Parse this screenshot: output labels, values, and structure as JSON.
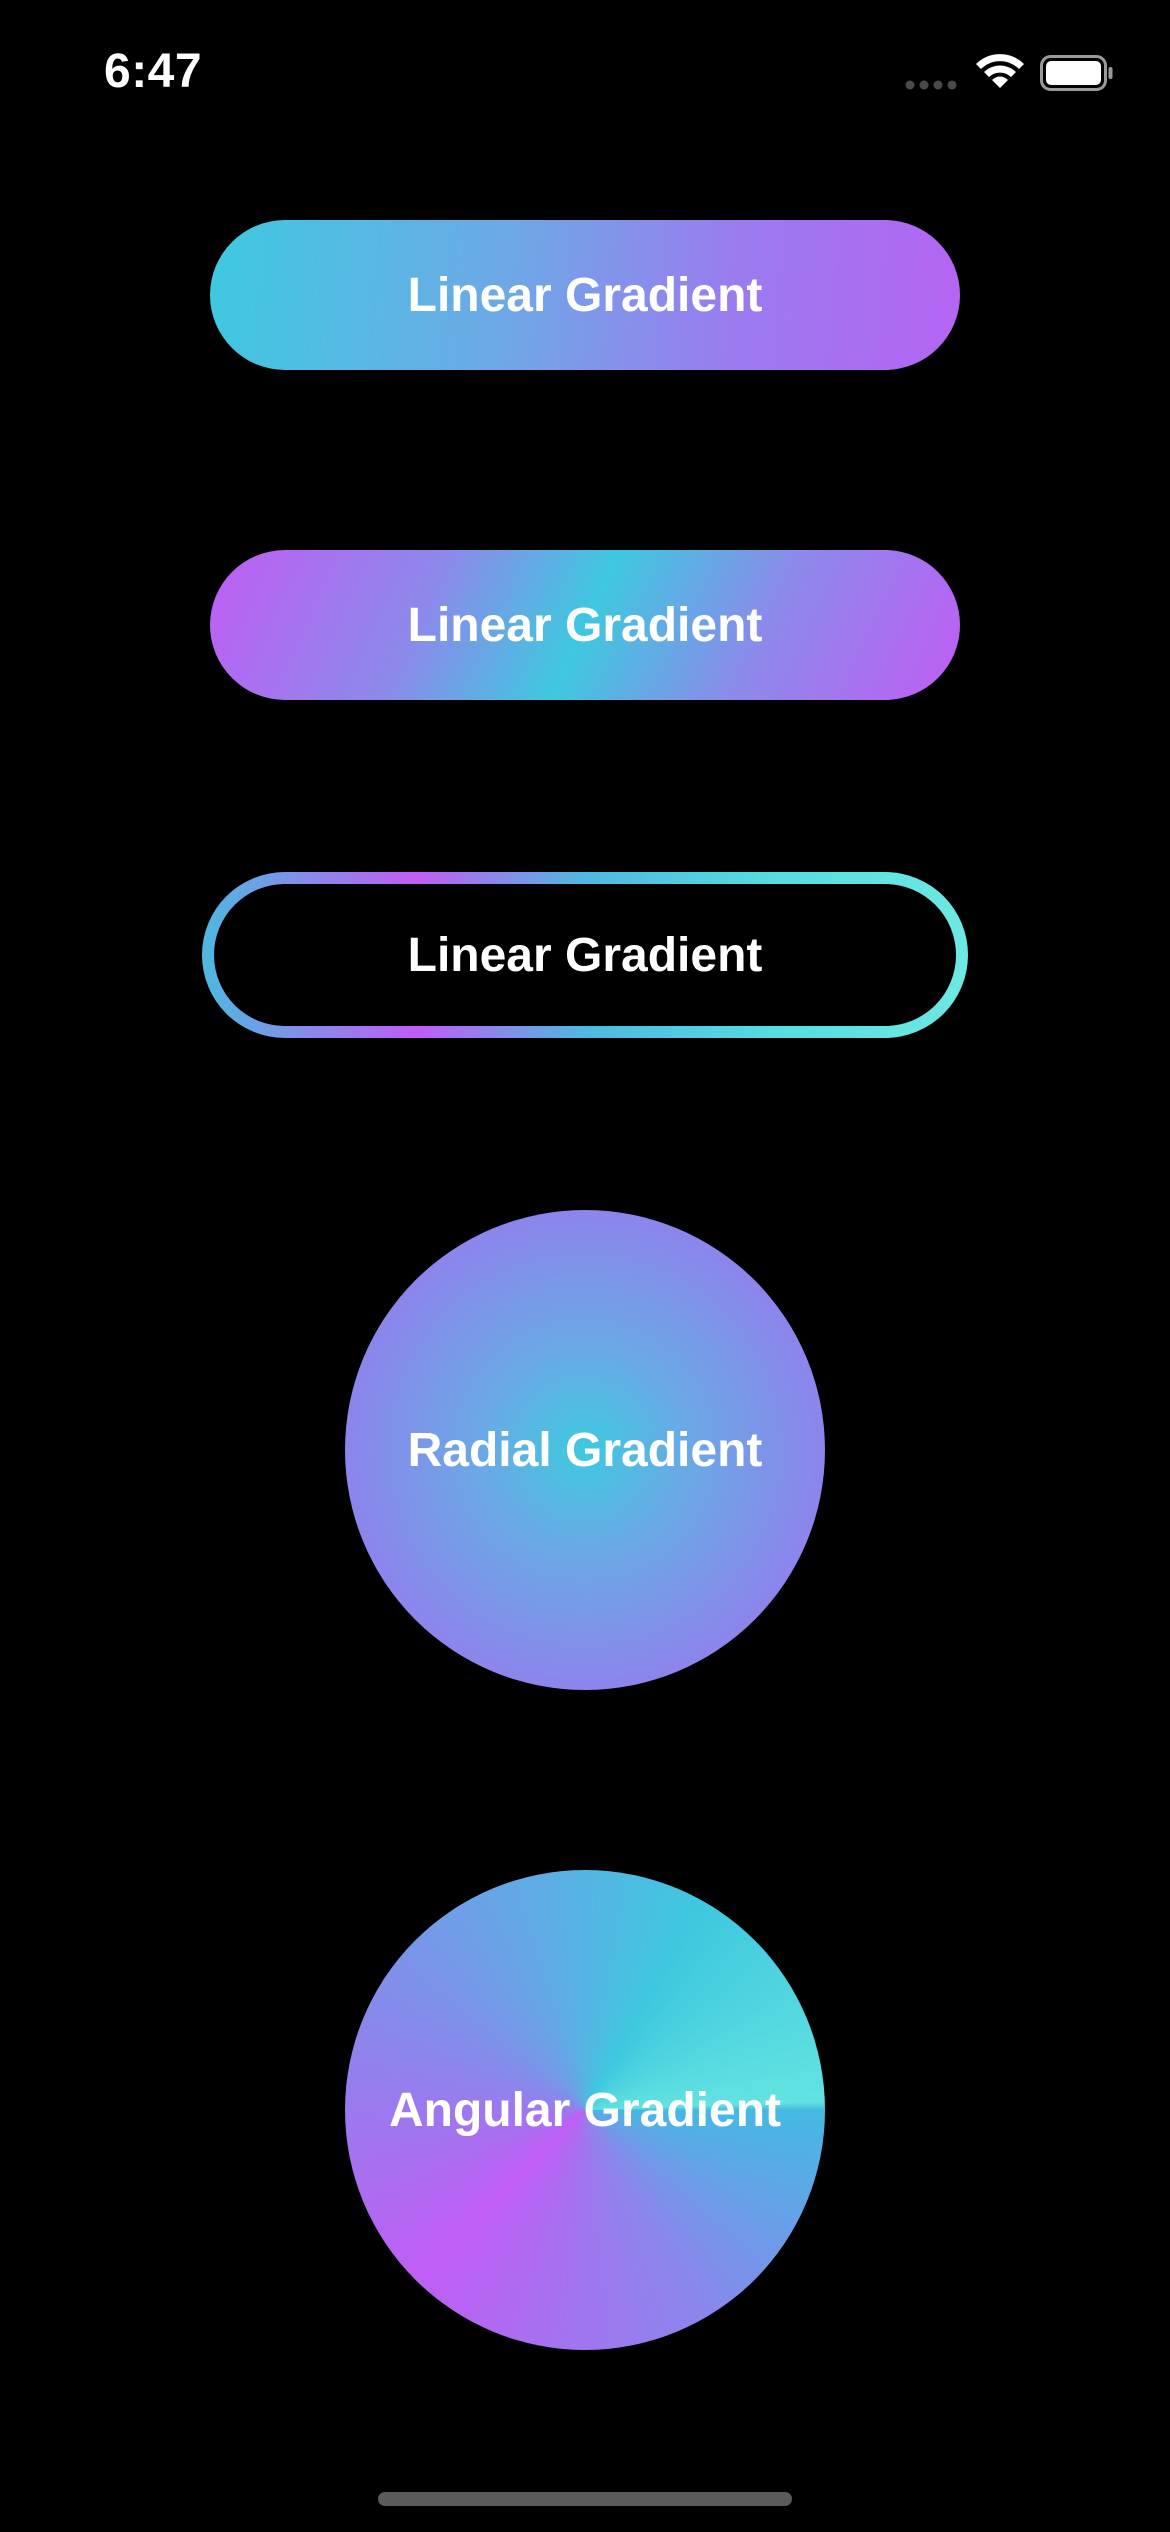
{
  "status_bar": {
    "time": "6:47",
    "icons": [
      "signal-dots-icon",
      "wifi-icon",
      "battery-icon"
    ]
  },
  "buttons": [
    {
      "label": "Linear Gradient",
      "style": "filled-horizontal",
      "colors": [
        "#3ec9e0",
        "#b564f3"
      ]
    },
    {
      "label": "Linear Gradient",
      "style": "filled-diagonal",
      "colors": [
        "#c05df5",
        "#3ec8df",
        "#c05df5"
      ]
    },
    {
      "label": "Linear Gradient",
      "style": "gradient-border",
      "colors": [
        "#4fb8e0",
        "#c05df5",
        "#6ee8e3"
      ]
    }
  ],
  "circles": [
    {
      "label": "Radial Gradient",
      "colors": [
        "#3ec9e0",
        "#8c85ec"
      ]
    },
    {
      "label": "Angular Gradient",
      "colors": [
        "#45b9e4",
        "#c05df5",
        "#3ec8df",
        "#62e2e0"
      ]
    }
  ],
  "theme": {
    "background": "#000000",
    "text": "#ffffff"
  }
}
